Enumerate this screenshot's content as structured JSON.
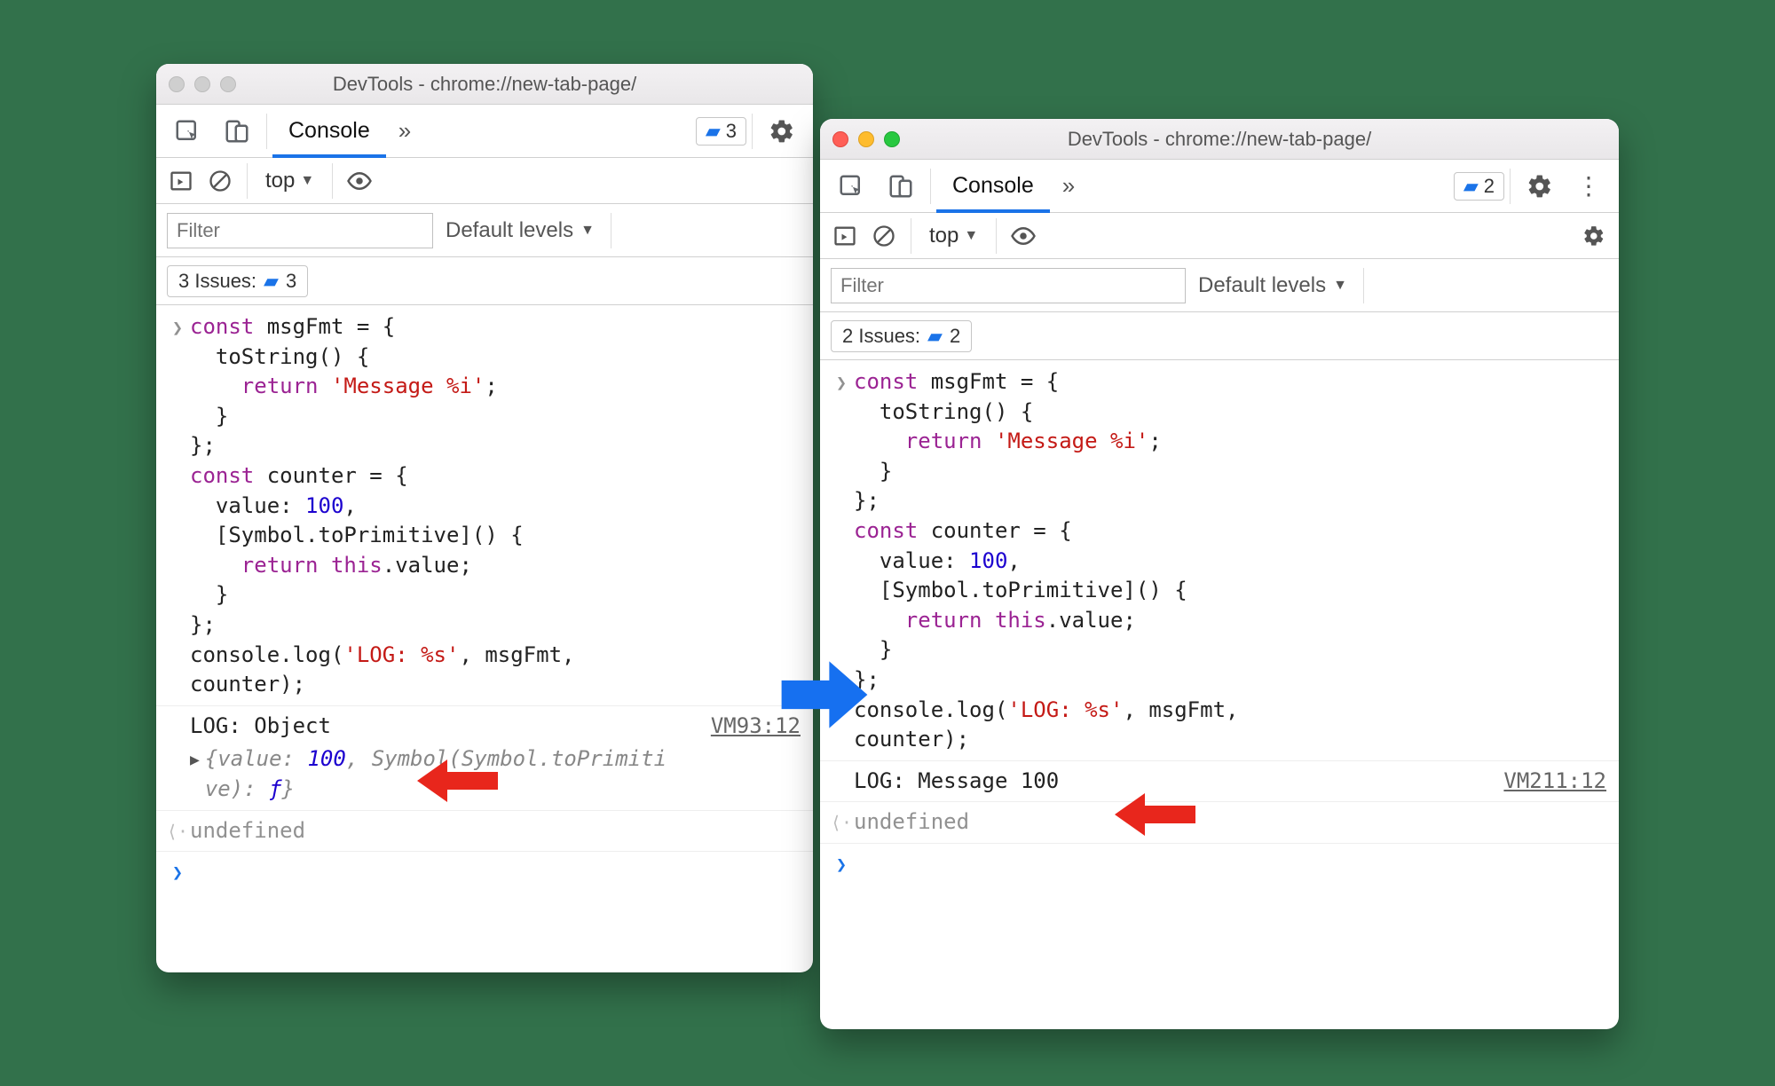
{
  "left": {
    "title": "DevTools - chrome://new-tab-page/",
    "tab": "Console",
    "badge_count": "3",
    "context": "top",
    "filter_placeholder": "Filter",
    "levels_label": "Default levels",
    "issues_label": "3 Issues:",
    "issues_count": "3",
    "log_output": "LOG: Object",
    "src_link": "VM93:12",
    "obj_preview": "{value: 100, Symbol(Symbol.toPrimitive): ƒ}",
    "undefined_label": "undefined"
  },
  "right": {
    "title": "DevTools - chrome://new-tab-page/",
    "tab": "Console",
    "badge_count": "2",
    "context": "top",
    "filter_placeholder": "Filter",
    "levels_label": "Default levels",
    "issues_label": "2 Issues:",
    "issues_count": "2",
    "log_output": "LOG: Message 100",
    "src_link": "VM211:12",
    "undefined_label": "undefined"
  },
  "code": {
    "l1a": "const",
    "l1b": " msgFmt = {",
    "l2": "  toString() {",
    "l3a": "    ",
    "l3b": "return",
    "l3c": " ",
    "l3d": "'Message %i'",
    "l3e": ";",
    "l4": "  }",
    "l5": "};",
    "l6a": "const",
    "l6b": " counter = {",
    "l7a": "  value: ",
    "l7b": "100",
    "l7c": ",",
    "l8": "  [Symbol.toPrimitive]() {",
    "l9a": "    ",
    "l9b": "return",
    "l9c": " ",
    "l9d": "this",
    "l9e": ".value;",
    "l10": "  }",
    "l11": "};",
    "l12a": "console.log(",
    "l12b": "'LOG: %s'",
    "l12c": ", msgFmt,",
    "l13": "counter);"
  }
}
